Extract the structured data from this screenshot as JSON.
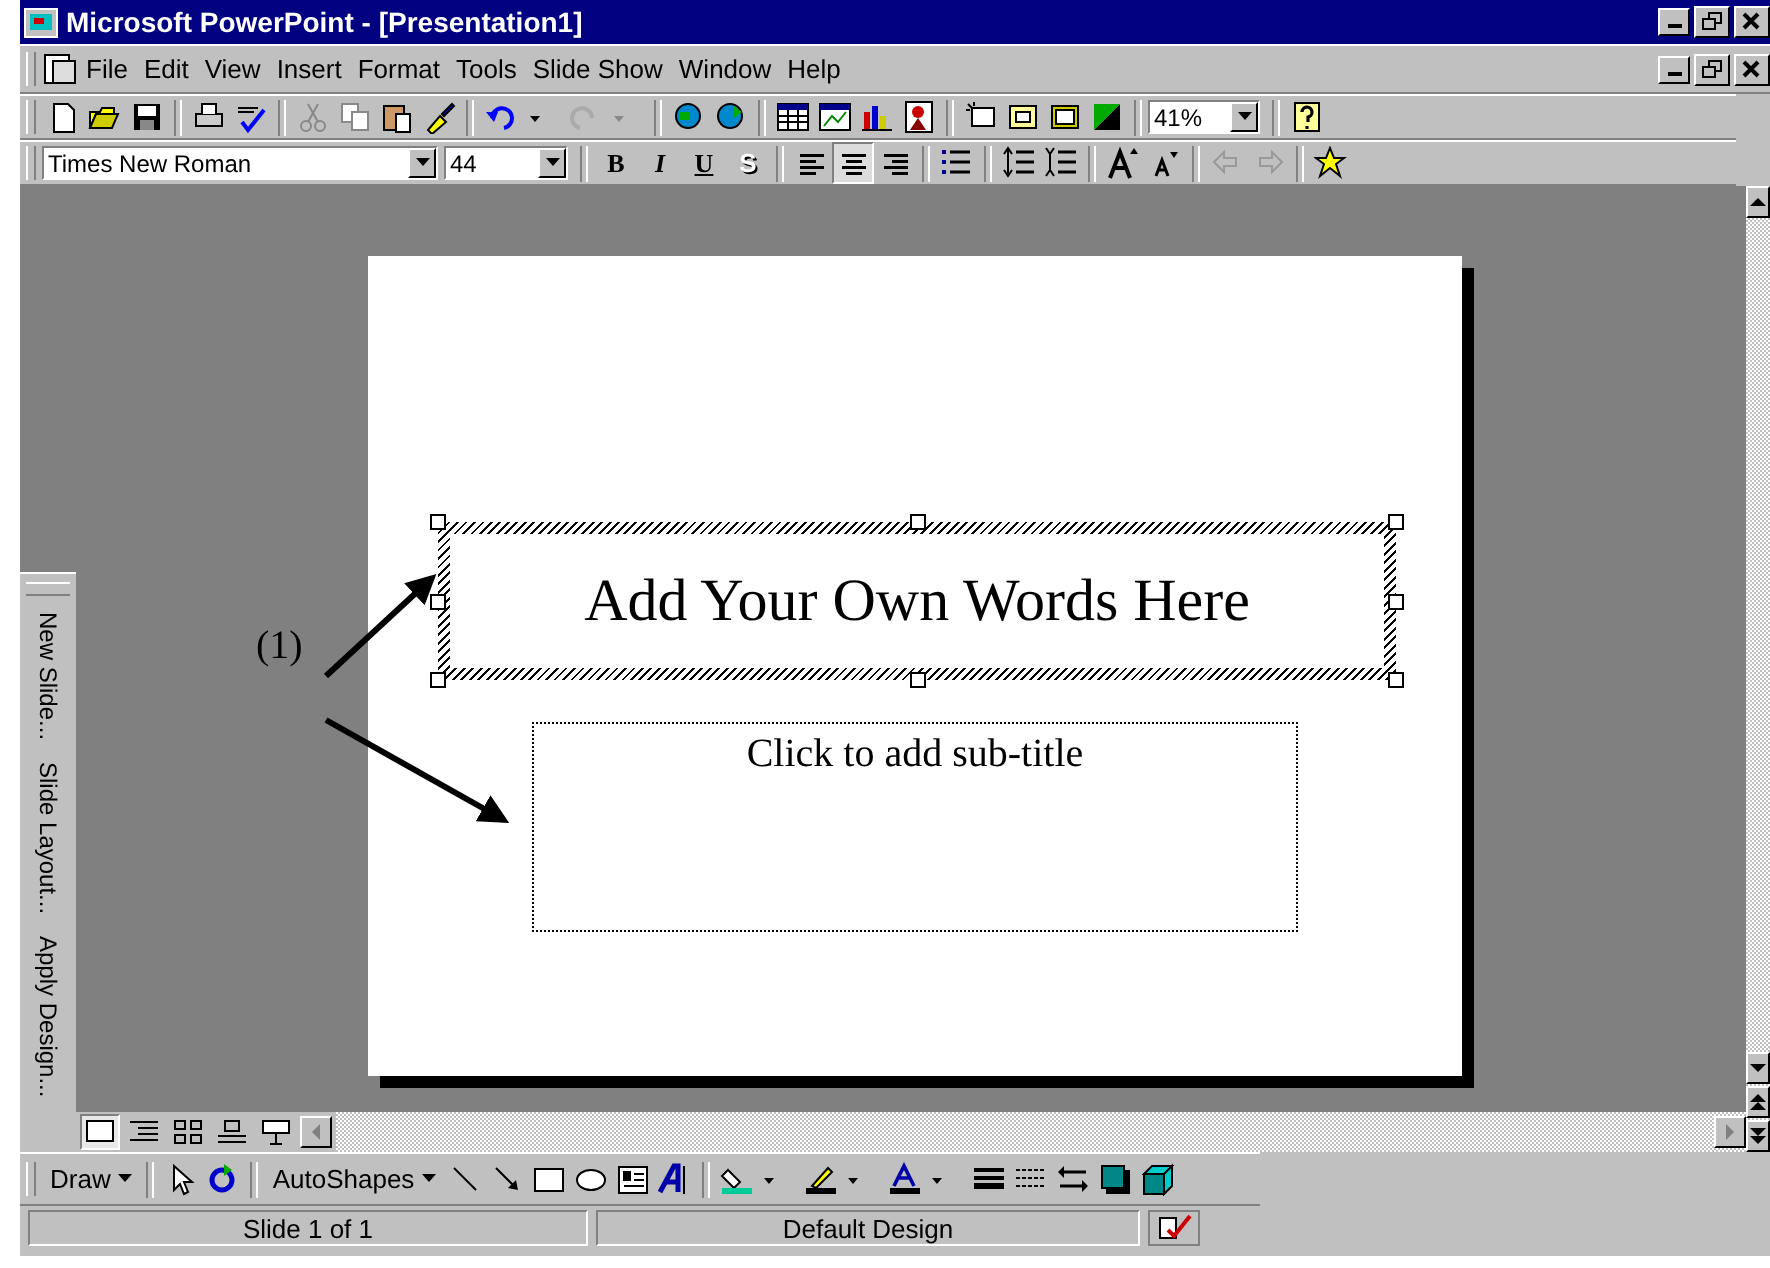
{
  "window": {
    "title": "Microsoft PowerPoint - [Presentation1]"
  },
  "menu": [
    "File",
    "Edit",
    "View",
    "Insert",
    "Format",
    "Tools",
    "Slide Show",
    "Window",
    "Help"
  ],
  "standard_toolbar": {
    "zoom": "41%"
  },
  "formatting_toolbar": {
    "font": "Times New Roman",
    "size": "44",
    "styles": [
      {
        "kind": "bold",
        "label": "B"
      },
      {
        "kind": "italic",
        "label": "I"
      },
      {
        "kind": "underline",
        "label": "U"
      },
      {
        "kind": "shadow",
        "label": "S"
      }
    ],
    "alignment": [
      {
        "kind": "left",
        "selected": false
      },
      {
        "kind": "center",
        "selected": true
      },
      {
        "kind": "right",
        "selected": false
      }
    ]
  },
  "side_toolbar": [
    "New Slide...",
    "Slide Layout...",
    "Apply Design..."
  ],
  "slide": {
    "title": {
      "text": "Add Your Own Words Here",
      "selected": true
    },
    "subtitle": {
      "placeholder": "Click to add sub-title",
      "selected": false
    }
  },
  "annotation": {
    "label": "(1)"
  },
  "view_buttons": [
    {
      "kind": "slide",
      "selected": true
    },
    {
      "kind": "outline",
      "selected": false
    },
    {
      "kind": "sorter",
      "selected": false
    },
    {
      "kind": "notes",
      "selected": false
    },
    {
      "kind": "show",
      "selected": false
    }
  ],
  "drawing_toolbar": {
    "draw": "Draw",
    "autoshapes": "AutoShapes"
  },
  "status_bar": [
    "Slide 1 of 1",
    "Default Design"
  ]
}
